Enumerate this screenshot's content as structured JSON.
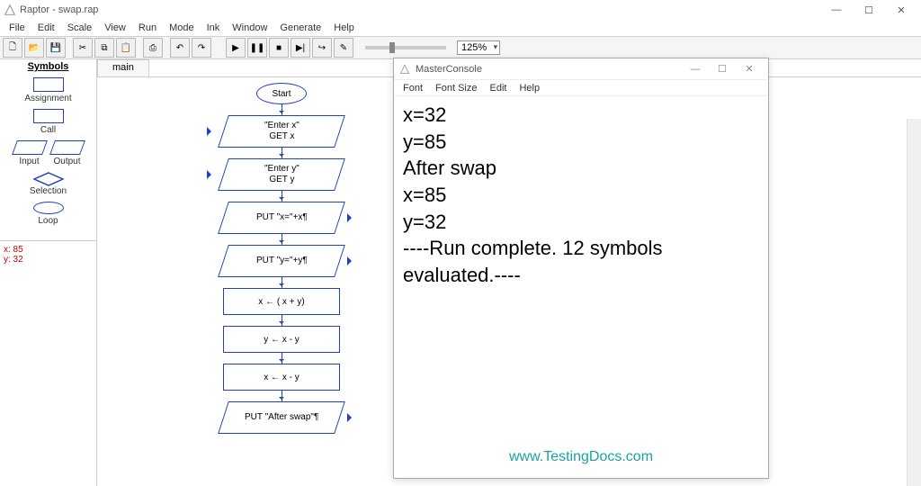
{
  "window": {
    "title": "Raptor - swap.rap"
  },
  "menus": [
    "File",
    "Edit",
    "Scale",
    "View",
    "Run",
    "Mode",
    "Ink",
    "Window",
    "Generate",
    "Help"
  ],
  "toolbar": {
    "zoom": "125%",
    "icons": [
      "new",
      "open",
      "save",
      "cut",
      "copy",
      "paste",
      "print",
      "undo",
      "redo",
      "sep",
      "run",
      "play",
      "pause",
      "stop",
      "step",
      "stepover",
      "pencil"
    ]
  },
  "symbols": {
    "title": "Symbols",
    "assignment": "Assignment",
    "call": "Call",
    "input": "Input",
    "output": "Output",
    "selection": "Selection",
    "loop": "Loop"
  },
  "watch": {
    "line1": "x: 85",
    "line2": "y: 32"
  },
  "tabs": {
    "main": "main"
  },
  "flow": {
    "start": "Start",
    "n1a": "\"Enter x\"",
    "n1b": "GET x",
    "n2a": "\"Enter y\"",
    "n2b": "GET y",
    "n3": "PUT \"x=\"+x¶",
    "n4": "PUT \"y=\"+y¶",
    "n5": "x ← ( x +  y)",
    "n6": "y ← x  -  y",
    "n7": "x ← x  -  y",
    "n8": "PUT \"After swap\"¶"
  },
  "console": {
    "title": "MasterConsole",
    "menus": [
      "Font",
      "Font Size",
      "Edit",
      "Help"
    ],
    "lines": [
      "x=32",
      "y=85",
      "After swap",
      "x=85",
      "y=32",
      "----Run complete.  12 symbols evaluated.----"
    ],
    "footer": "www.TestingDocs.com"
  }
}
